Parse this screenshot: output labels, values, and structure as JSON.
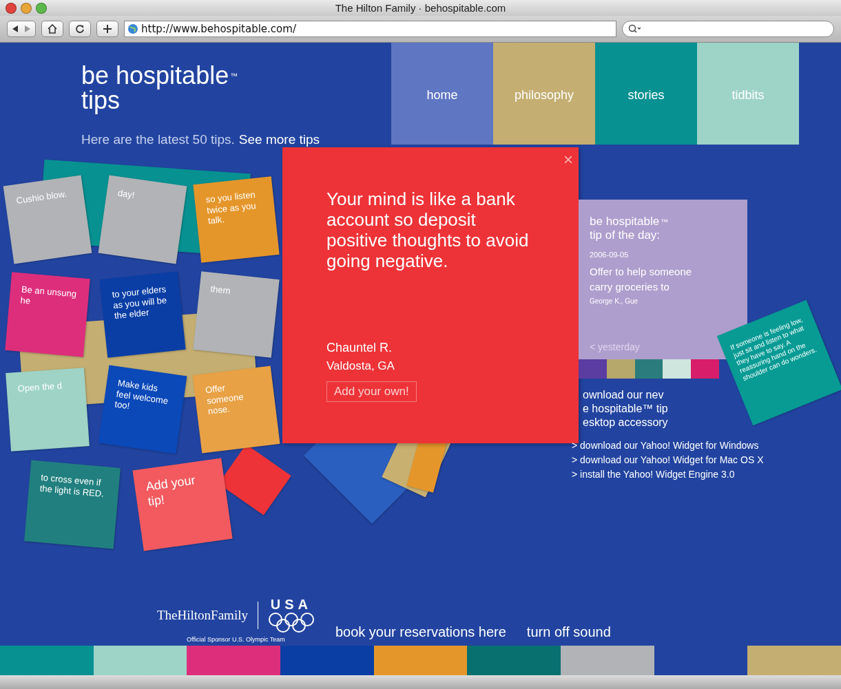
{
  "window": {
    "title": "The Hilton Family · behospitable.com"
  },
  "toolbar": {
    "address": "http://www.behospitable.com/"
  },
  "header": {
    "logo_line_1": "be hospitable",
    "logo_mark": "™",
    "logo_line_2": "tips",
    "intro": "Here are the latest 50 tips.",
    "more_link": "See more tips"
  },
  "nav": [
    {
      "label": "home",
      "color": "#5f76c2"
    },
    {
      "label": "philosophy",
      "color": "#c4ae72"
    },
    {
      "label": "stories",
      "color": "#079191"
    },
    {
      "label": "tidbits",
      "color": "#9ed3c8"
    }
  ],
  "tip_cards": [
    {
      "text": "Cushio blow.",
      "color": "#b1b3b6"
    },
    {
      "text": "day!",
      "color": "#b1b3b6"
    },
    {
      "text": "so you listen twice as you talk.",
      "color": "#e5962a"
    },
    {
      "text": "Be an unsung he",
      "color": "#dd2e7c"
    },
    {
      "text": "to your elders as you will be the elder",
      "color": "#0a3ea5"
    },
    {
      "text": "them",
      "color": "#b1b3b6"
    },
    {
      "text": "Open the d",
      "color": "#9ed3c5"
    },
    {
      "text": "Make kids feel welcome too!",
      "color": "#0b48b8"
    },
    {
      "text": "Offer someone nose.",
      "color": "#e8a145"
    },
    {
      "text": "to cross even if the light is RED.",
      "color": "#21807f"
    },
    {
      "text": "Add your tip!",
      "color": "#f25a5f"
    },
    {
      "text": "If someone is feeling low, just sit and listen to what they have to say. A reassuring hand on the shoulder can do wonders.",
      "color": "#079b94"
    }
  ],
  "popup": {
    "close": "×",
    "tip": "Your mind is like a bank account so deposit positive thoughts to avoid going negative.",
    "author": "Chauntel R.",
    "place": "Valdosta, GA",
    "button": "Add your own!"
  },
  "tip_of_the_day": {
    "title_1": "be hospitable",
    "mark": "™",
    "title_2": "tip of the day:",
    "date": "2006-09-05",
    "tip": "Offer to help someone carry groceries to",
    "author": "George K., Gue",
    "prev": "< yesterday"
  },
  "download": {
    "lines": [
      "ownload our nev",
      "e hospitable™ tip",
      "esktop accessory"
    ],
    "links": [
      "> download our Yahoo! Widget for Windows",
      "> download our Yahoo! Widget for Mac OS X",
      "> install the Yahoo! Widget Engine 3.0"
    ]
  },
  "footer": {
    "brand": "TheHiltonFamily",
    "sponsor": "Official Sponsor U.S. Olympic Team",
    "usa": "USA",
    "links": [
      "book your reservations here",
      "turn off sound"
    ]
  }
}
